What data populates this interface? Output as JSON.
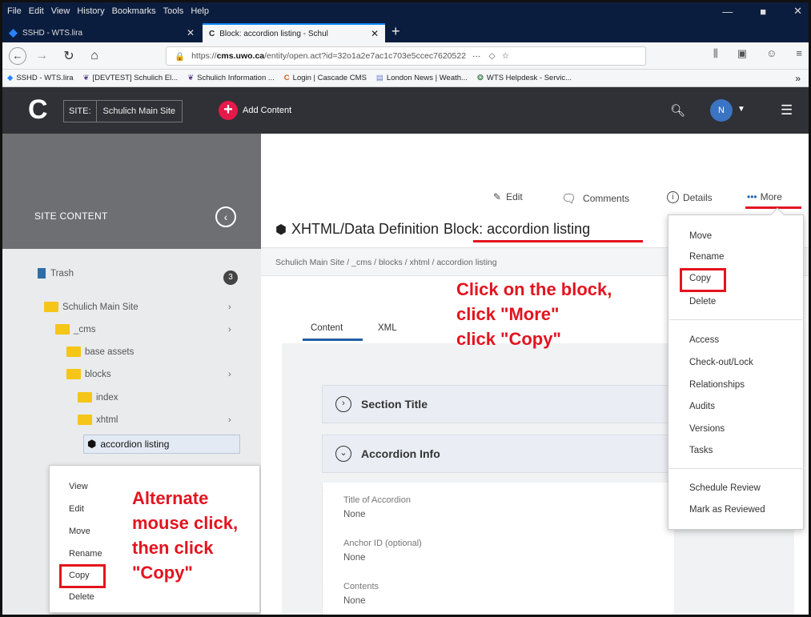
{
  "browser": {
    "menu": [
      "File",
      "Edit",
      "View",
      "History",
      "Bookmarks",
      "Tools",
      "Help"
    ],
    "tabs": [
      {
        "label": "SSHD - WTS.lira"
      },
      {
        "label": "Block: accordion listing - Schul"
      }
    ],
    "url_prefix": "https://",
    "url_domain": "cms.uwo.ca",
    "url_rest": "/entity/open.act?id=32o1a2e7ac1c703e5ccec7620522",
    "url_more": "···",
    "bookmarks": [
      "SSHD - WTS.lira",
      "[DEVTEST] Schulich El...",
      "Schulich Information ...",
      "Login | Cascade CMS",
      "London News | Weath...",
      "WTS Helpdesk - Servic..."
    ],
    "bookmarks_more": "»"
  },
  "header": {
    "site_label": "SITE:",
    "site_value": "Schulich Main Site",
    "add_content": "Add Content",
    "avatar_initial": "N"
  },
  "sidebar": {
    "title": "SITE CONTENT",
    "trash_label": "Trash",
    "trash_count": "3",
    "tree": [
      {
        "label": "Schulich Main Site"
      },
      {
        "label": "_cms"
      },
      {
        "label": "base assets"
      },
      {
        "label": "blocks"
      },
      {
        "label": "index"
      },
      {
        "label": "xhtml"
      }
    ],
    "selected": "accordion listing"
  },
  "context_menu": {
    "items": [
      "View",
      "Edit",
      "Move",
      "Rename",
      "Copy",
      "Delete"
    ]
  },
  "annotations": {
    "left": [
      "Alternate",
      "mouse click,",
      "then click",
      "\"Copy\""
    ],
    "right": [
      "Click on the block,",
      "click \"More\"",
      "click \"Copy\""
    ]
  },
  "main": {
    "toolbar": {
      "edit": "Edit",
      "comments": "Comments",
      "details": "Details",
      "more": "More"
    },
    "title_prefix": "XHTML/Data Definition",
    "title_block": "Block: accordion listing",
    "breadcrumb": "Schulich Main Site / _cms / blocks / xhtml / accordion listing",
    "tabs": {
      "content": "Content",
      "xml": "XML"
    },
    "sections": {
      "section_title": "Section Title",
      "accordion_info": "Accordion Info"
    },
    "fields": [
      {
        "label": "Title of Accordion",
        "value": "None"
      },
      {
        "label": "Anchor ID (optional)",
        "value": "None"
      },
      {
        "label": "Contents",
        "value": "None"
      }
    ]
  },
  "more_menu": {
    "group1": [
      "Move",
      "Rename",
      "Copy",
      "Delete"
    ],
    "group2": [
      "Access",
      "Check-out/Lock",
      "Relationships",
      "Audits",
      "Versions",
      "Tasks"
    ],
    "group3": [
      "Schedule Review",
      "Mark as Reviewed"
    ]
  },
  "colors": {
    "accent_red": "#e3141f",
    "header_bg": "#2f3136",
    "add_button": "#e5194a",
    "browser_bg": "#0b1d3e"
  }
}
